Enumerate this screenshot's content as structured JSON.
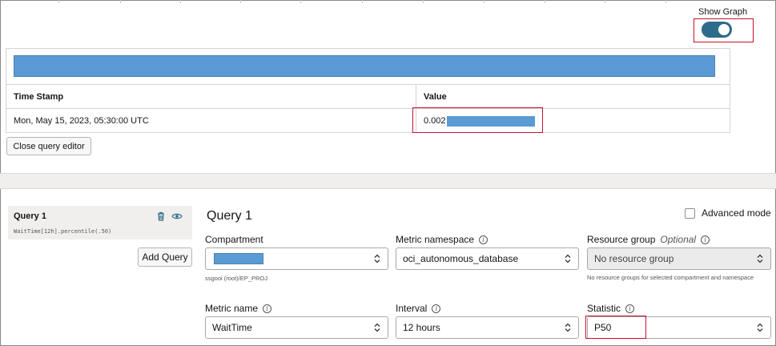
{
  "graph": {
    "show_graph_label": "Show Graph",
    "show_graph_on": true
  },
  "results": {
    "columns": [
      "Time Stamp",
      "Value"
    ],
    "rows": [
      {
        "timestamp": "Mon, May 15, 2023, 05:30:00 UTC",
        "value": "0.002"
      }
    ]
  },
  "buttons": {
    "close_query_editor": "Close query editor",
    "add_query": "Add Query"
  },
  "query": {
    "card_title": "Query 1",
    "expression": "WaitTime[12h].percentile(.50)",
    "heading": "Query 1",
    "advanced_mode_label": "Advanced mode",
    "advanced_mode_checked": false
  },
  "fields": {
    "compartment": {
      "label": "Compartment",
      "value": "",
      "helper": "ssgooi (root)/EP_PROJ"
    },
    "metric_namespace": {
      "label": "Metric namespace",
      "value": "oci_autonomous_database"
    },
    "resource_group": {
      "label": "Resource group",
      "optional": "Optional",
      "value": "No resource group",
      "helper": "No resource groups for selected compartment and namespace"
    },
    "metric_name": {
      "label": "Metric name",
      "value": "WaitTime"
    },
    "interval": {
      "label": "Interval",
      "value": "12 hours"
    },
    "statistic": {
      "label": "Statistic",
      "value": "P50"
    }
  },
  "icons": {
    "delete": "trash-icon",
    "visibility": "eye-icon",
    "info": "info-icon",
    "caret": "up-down-caret-icon"
  },
  "colors": {
    "accent": "#2e6b8a",
    "redaction": "#5b9bd5",
    "highlight": "#c8102e",
    "panel": "#f1efed"
  }
}
